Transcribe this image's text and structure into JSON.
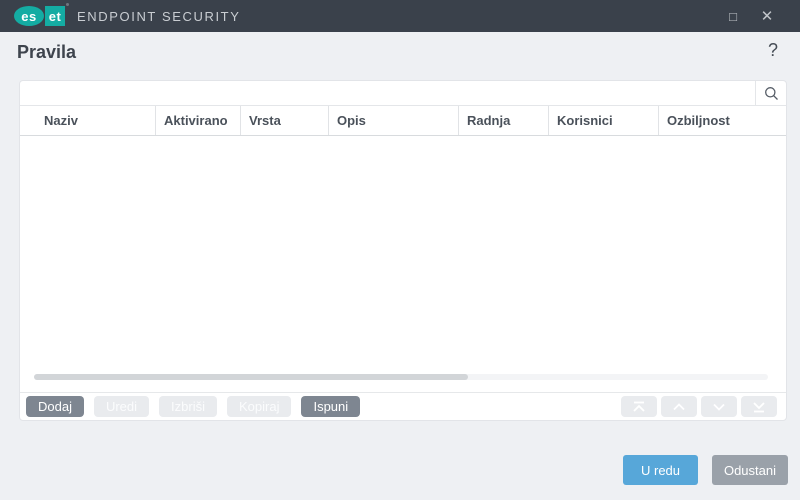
{
  "titlebar": {
    "logo_es": "es",
    "logo_et": "et",
    "product": "ENDPOINT SECURITY",
    "maximize_glyph": "□",
    "close_glyph": "✕"
  },
  "page": {
    "title": "Pravila",
    "help_glyph": "?"
  },
  "search": {
    "value": "",
    "placeholder": "",
    "icon": "magnifier-icon"
  },
  "table": {
    "columns": [
      "Naziv",
      "Aktivirano",
      "Vrsta",
      "Opis",
      "Radnja",
      "Korisnici",
      "Ozbiljnost"
    ],
    "rows": []
  },
  "actions": {
    "dodaj": {
      "label": "Dodaj",
      "enabled": true
    },
    "uredi": {
      "label": "Uredi",
      "enabled": false
    },
    "izbrisi": {
      "label": "Izbriši",
      "enabled": false
    },
    "kopiraj": {
      "label": "Kopiraj",
      "enabled": false
    },
    "ispuni": {
      "label": "Ispuni",
      "enabled": true
    }
  },
  "move_icons": [
    "move-top-icon",
    "move-up-icon",
    "move-down-icon",
    "move-bottom-icon"
  ],
  "footer": {
    "ok": "U redu",
    "cancel": "Odustani"
  },
  "colors": {
    "titlebar": "#3A414B",
    "brand_teal": "#14ACA3",
    "page_background": "#EEF0F3",
    "primary_button": "#57A7D9",
    "secondary_button": "#9AA1A9",
    "action_enabled": "#7E8691",
    "action_disabled": "#E9EBEE"
  }
}
